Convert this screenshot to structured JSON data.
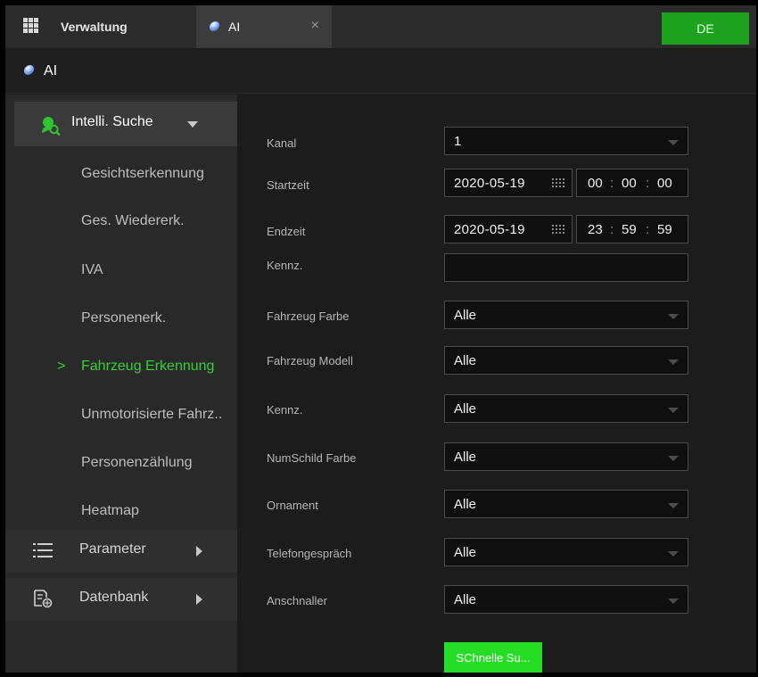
{
  "tabs": {
    "home_label": "Verwaltung",
    "ai_label": "AI",
    "close_glyph": "×",
    "lang_label": "DE"
  },
  "page": {
    "title": "AI"
  },
  "sidebar": {
    "section": {
      "label": "Intelli. Suche",
      "icon": "intelligent-search-icon"
    },
    "items": [
      {
        "label": "Gesichtserkennung"
      },
      {
        "label": "Ges. Wiedererk."
      },
      {
        "label": "IVA"
      },
      {
        "label": "Personenerk."
      },
      {
        "label": "Fahrzeug Erkennung",
        "active": true,
        "chevron": ">"
      },
      {
        "label": "Unmotorisierte Fahrz.."
      },
      {
        "label": "Personenzählung"
      },
      {
        "label": "Heatmap"
      }
    ],
    "groups": [
      {
        "label": "Parameter",
        "icon": "list-icon"
      },
      {
        "label": "Datenbank",
        "icon": "database-icon"
      }
    ]
  },
  "form": {
    "kanal": {
      "label": "Kanal",
      "value": "1"
    },
    "startzeit": {
      "label": "Startzeit",
      "date": "2020-05-19",
      "h": "00",
      "m": "00",
      "s": "00",
      "sep": ":"
    },
    "endzeit": {
      "label": "Endzeit",
      "date": "2020-05-19",
      "h": "23",
      "m": "59",
      "s": "59",
      "sep": ":"
    },
    "kennz_text": {
      "label": "Kennz.",
      "value": ""
    },
    "fahrzeug_farbe": {
      "label": "Fahrzeug Farbe",
      "value": "Alle"
    },
    "fahrzeug_modell": {
      "label": "Fahrzeug Modell",
      "value": "Alle"
    },
    "kennz_select": {
      "label": "Kennz.",
      "value": "Alle"
    },
    "numschild_farbe": {
      "label": "NumSchild Farbe",
      "value": "Alle"
    },
    "ornament": {
      "label": "Ornament",
      "value": "Alle"
    },
    "telefongespraech": {
      "label": "Telefongespräch",
      "value": "Alle"
    },
    "anschnaller": {
      "label": "Anschnaller",
      "value": "Alle"
    },
    "search_button": "SChnelle Su..."
  },
  "colors": {
    "accent_green": "#24dd24",
    "active_text_green": "#34d134",
    "lang_button_green": "#1fa21f"
  }
}
